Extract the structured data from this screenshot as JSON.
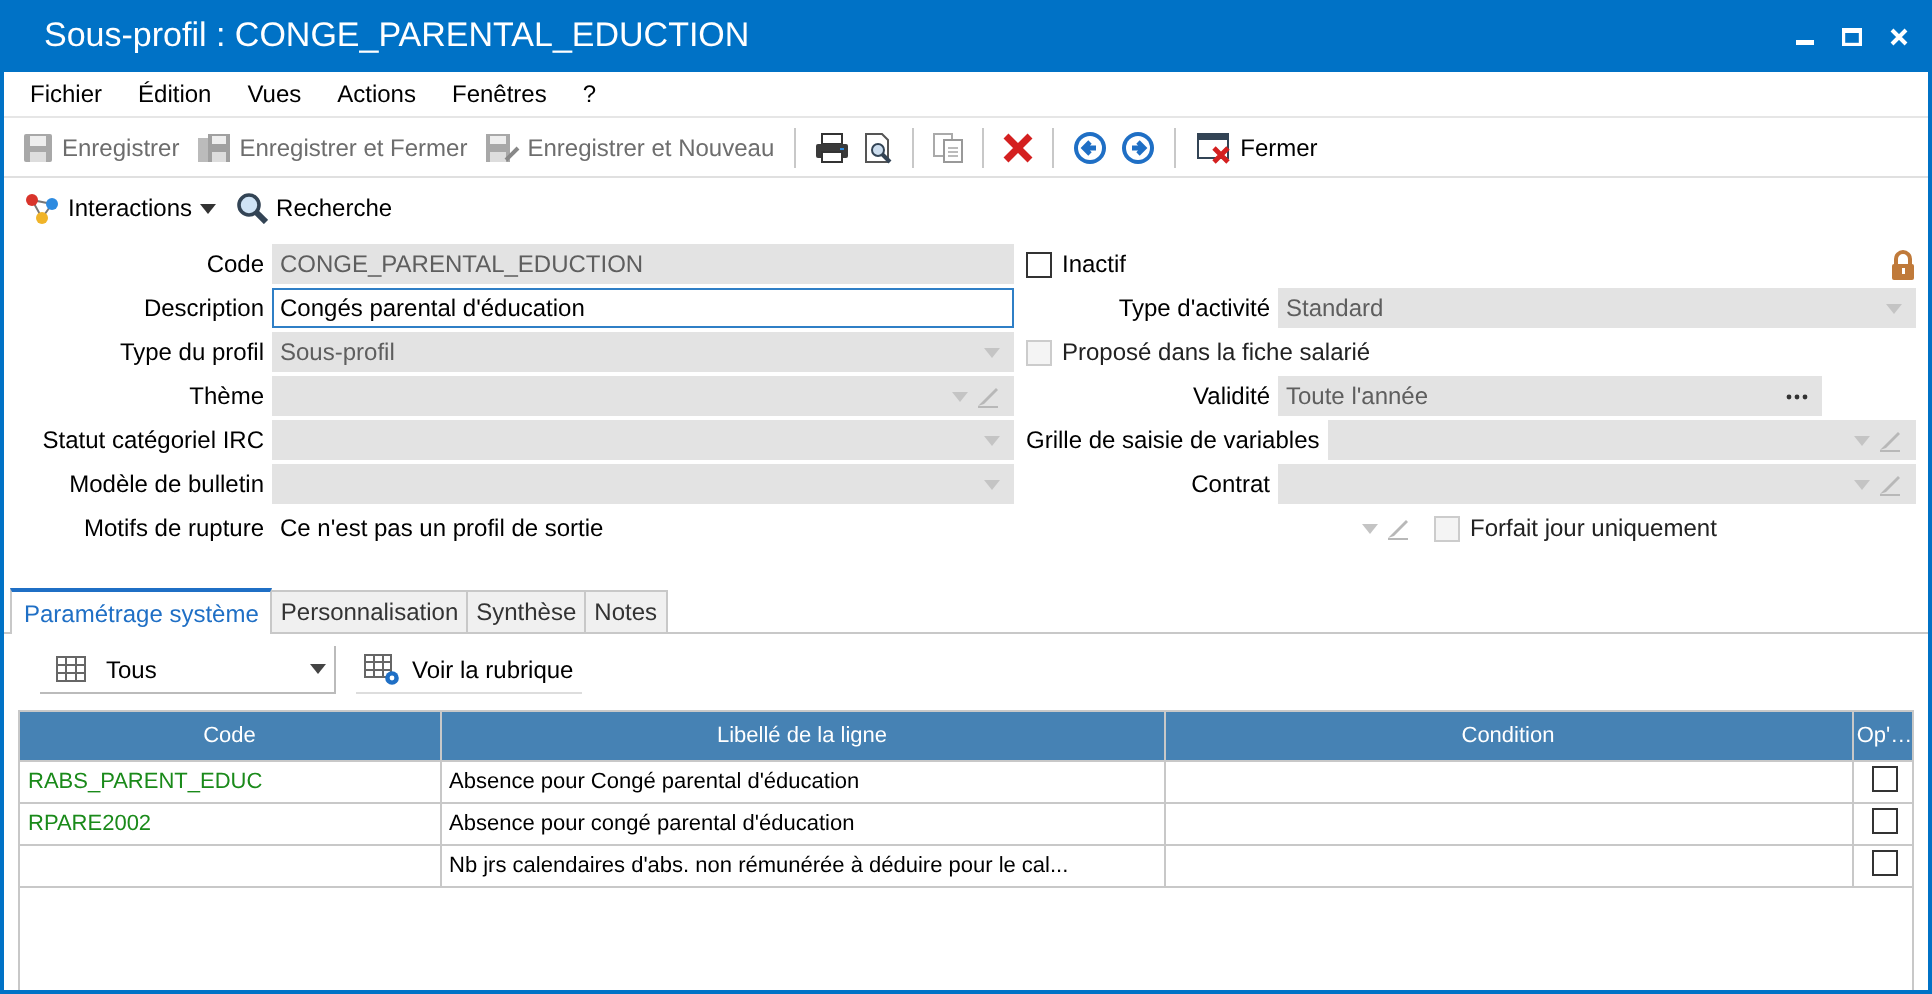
{
  "window": {
    "title": "Sous-profil : CONGE_PARENTAL_EDUCTION"
  },
  "menu": [
    "Fichier",
    "Édition",
    "Vues",
    "Actions",
    "Fenêtres",
    "?"
  ],
  "toolbar": [
    {
      "label": "Enregistrer",
      "disabled": true
    },
    {
      "label": "Enregistrer et Fermer",
      "disabled": true
    },
    {
      "label": "Enregistrer et Nouveau",
      "disabled": true
    },
    {
      "label": "Fermer",
      "disabled": false
    }
  ],
  "actions": [
    {
      "label": "Interactions",
      "kind": "menu"
    },
    {
      "label": "Recherche",
      "kind": "button"
    }
  ],
  "form": {
    "locked": true,
    "rows": [
      {
        "left": {
          "label": "Code",
          "kind": "text",
          "value": "CONGE_PARENTAL_EDUCTION",
          "disabled": true
        },
        "right": {
          "kind": "checkbox",
          "label": "Inactif",
          "checked": false,
          "disabled": false
        }
      },
      {
        "left": {
          "label": "Description",
          "kind": "text",
          "value": "Congés parental d'éducation",
          "disabled": false
        },
        "right": {
          "label": "Type d'activité",
          "kind": "dropdown",
          "value": "Standard",
          "disabled": true
        }
      },
      {
        "left": {
          "label": "Type du profil",
          "kind": "dropdown",
          "value": "Sous-profil",
          "disabled": true
        },
        "right": {
          "kind": "checkbox",
          "label": "Proposé dans la fiche salarié",
          "checked": false,
          "disabled": true
        }
      },
      {
        "left": {
          "label": "Thème",
          "kind": "dropdown-edit",
          "disabled": true
        },
        "right": {
          "label": "Validité",
          "kind": "ellipsis",
          "value": "Toute l'année",
          "disabled": true
        }
      },
      {
        "left": {
          "label": "Statut catégoriel IRC",
          "kind": "dropdown",
          "disabled": true
        },
        "right": {
          "label": "Grille de saisie de variables",
          "kind": "dropdown-edit",
          "disabled": true
        }
      },
      {
        "left": {
          "label": "Modèle de bulletin",
          "kind": "dropdown",
          "disabled": true
        },
        "right": {
          "label": "Contrat",
          "kind": "dropdown-edit",
          "disabled": true
        }
      },
      {
        "left": {
          "label": "Motifs de rupture",
          "kind": "static",
          "value": "Ce n'est pas un profil de sortie"
        },
        "right": {
          "kind": "edit-checkbox",
          "label": "Forfait jour uniquement",
          "checked": false,
          "disabled": true
        }
      }
    ]
  },
  "tabs": [
    {
      "label": "Paramétrage système",
      "selected": true
    },
    {
      "label": "Personnalisation",
      "selected": false
    },
    {
      "label": "Synthèse",
      "selected": false
    },
    {
      "label": "Notes",
      "selected": false
    }
  ],
  "filter": {
    "value": "Tous"
  },
  "view_button": {
    "label": "Voir la rubrique"
  },
  "table": {
    "columns": [
      "Code",
      "Libellé de la ligne",
      "Condition",
      "Op'…"
    ],
    "rows": [
      {
        "code": "RABS_PARENT_EDUC",
        "label": "Absence pour Congé parental d'éducation",
        "condition": "",
        "checked": false
      },
      {
        "code": "RPARE2002",
        "label": "Absence pour congé parental d'éducation",
        "condition": "",
        "checked": false
      },
      {
        "code": "",
        "label": "Nb jrs calendaires d'abs. non rémunérée à déduire pour le cal...",
        "condition": "",
        "checked": false
      }
    ]
  }
}
